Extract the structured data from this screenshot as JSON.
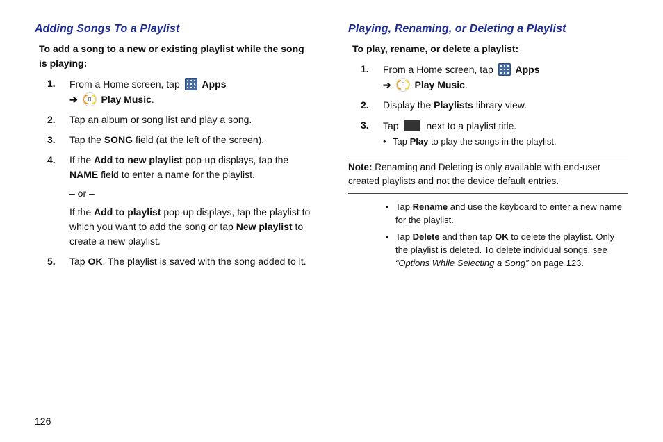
{
  "page_number": "126",
  "left": {
    "title": "Adding Songs To a Playlist",
    "intro": "To add a song to a new or existing playlist while the song is playing:",
    "steps": [
      {
        "num": "1.",
        "pre": "From a Home screen, tap ",
        "apps": "Apps",
        "arrow": "➔",
        "play": "Play Music",
        "post": "."
      },
      {
        "num": "2.",
        "text": "Tap an album or song list and play a song."
      },
      {
        "num": "3.",
        "pre": "Tap the ",
        "bold": "SONG",
        "post": " field (at the left of the screen)."
      },
      {
        "num": "4.",
        "l4a": {
          "pre": "If the ",
          "b1": "Add to new playlist",
          "mid": " pop-up displays, tap the ",
          "b2": "NAME",
          "post": " field to enter a name for the playlist."
        },
        "or": "– or –",
        "l4b": {
          "pre": "If the ",
          "b1": "Add to playlist",
          "mid": " pop-up displays, tap the playlist to which you want to add the song or tap ",
          "b2": "New playlist",
          "post": " to create a new playlist."
        }
      },
      {
        "num": "5.",
        "pre": "Tap ",
        "bold": "OK",
        "post": ". The playlist is saved with the song added to it."
      }
    ]
  },
  "right": {
    "title": "Playing, Renaming, or Deleting a Playlist",
    "intro": "To play, rename, or delete a playlist:",
    "steps": [
      {
        "num": "1.",
        "pre": "From a Home screen, tap ",
        "apps": "Apps",
        "arrow": "➔",
        "play": "Play Music",
        "post": "."
      },
      {
        "num": "2.",
        "pre": "Display the ",
        "bold": "Playlists",
        "post": " library view."
      },
      {
        "num": "3.",
        "pre": "Tap ",
        "post": " next to a playlist title.",
        "bullet": {
          "pre": "Tap ",
          "b": "Play",
          "post": " to play the songs in the playlist."
        }
      }
    ],
    "note": {
      "label": "Note:",
      "body": "Renaming and Deleting is only available with end-user created playlists and not the device default entries."
    },
    "post_note_bullets": [
      {
        "pre": "Tap ",
        "b": "Rename",
        "post": " and use the keyboard to enter a new name for the playlist."
      },
      {
        "pre": "Tap ",
        "b": "Delete",
        "mid": " and then tap ",
        "b2": "OK",
        "post": " to delete the playlist. Only the playlist is deleted. To delete individual songs, see ",
        "ref": "“Options While Selecting a Song”",
        "tail": " on page 123."
      }
    ]
  }
}
